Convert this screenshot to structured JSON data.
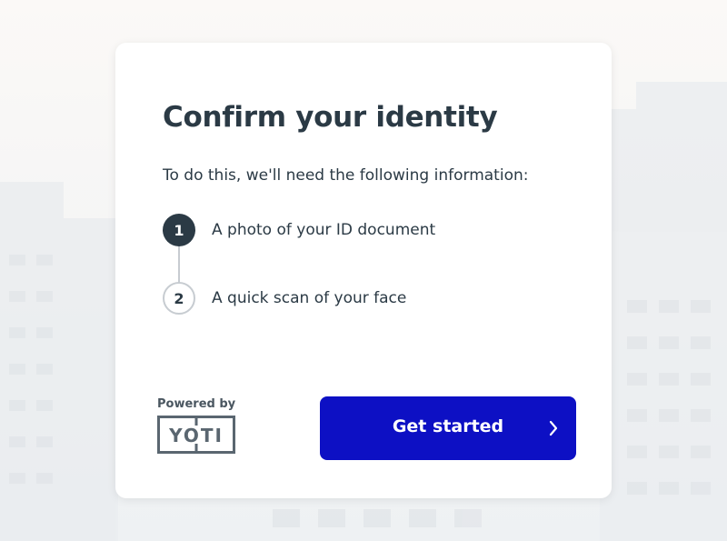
{
  "card": {
    "title": "Confirm your identity",
    "subtitle": "To do this, we'll need the following information:",
    "steps": [
      {
        "number": "1",
        "label": "A photo of your ID document",
        "state": "active"
      },
      {
        "number": "2",
        "label": "A quick scan of your face",
        "state": "pending"
      }
    ]
  },
  "branding": {
    "powered_by": "Powered by",
    "logo_text": "YOTI"
  },
  "actions": {
    "get_started": "Get started",
    "chevron_icon": "chevron-right-icon"
  },
  "colors": {
    "primary_button": "#0d10c4",
    "text_dark": "#2b3a45",
    "step_inactive_border": "#c7ccd1"
  }
}
